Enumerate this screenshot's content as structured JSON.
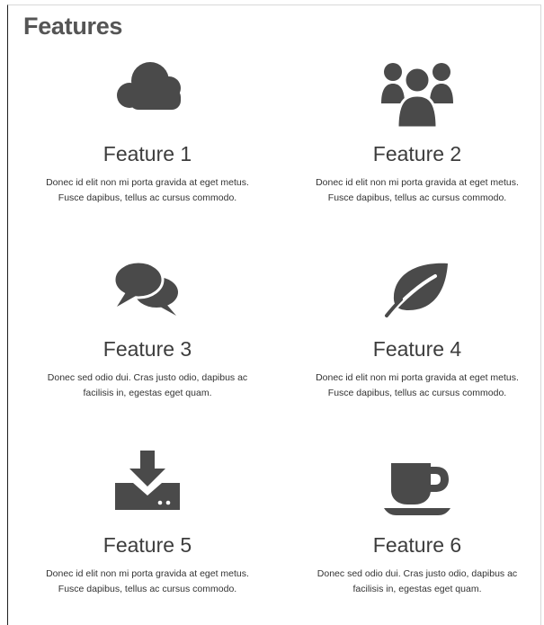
{
  "page": {
    "title": "Features"
  },
  "colors": {
    "icon": "#4a4a4a",
    "heading": "#3d3d3d",
    "text": "#333333"
  },
  "features": [
    {
      "icon": "cloud-icon",
      "name": "Feature 1",
      "line1": "Donec id elit non mi porta gravida at eget metus.",
      "line2": "Fusce dapibus, tellus ac cursus commodo."
    },
    {
      "icon": "users-icon",
      "name": "Feature 2",
      "line1": "Donec id elit non mi porta gravida at eget metus.",
      "line2": "Fusce dapibus, tellus ac cursus commodo."
    },
    {
      "icon": "chat-icon",
      "name": "Feature 3",
      "line1": "Donec sed odio dui. Cras justo odio, dapibus ac",
      "line2": "facilisis in, egestas eget quam."
    },
    {
      "icon": "leaf-icon",
      "name": "Feature 4",
      "line1": "Donec id elit non mi porta gravida at eget metus.",
      "line2": "Fusce dapibus, tellus ac cursus commodo."
    },
    {
      "icon": "download-icon",
      "name": "Feature 5",
      "line1": "Donec id elit non mi porta gravida at eget metus.",
      "line2": "Fusce dapibus, tellus ac cursus commodo."
    },
    {
      "icon": "coffee-cup-icon",
      "name": "Feature 6",
      "line1": "Donec sed odio dui. Cras justo odio, dapibus ac",
      "line2": "facilisis in, egestas eget quam."
    }
  ]
}
